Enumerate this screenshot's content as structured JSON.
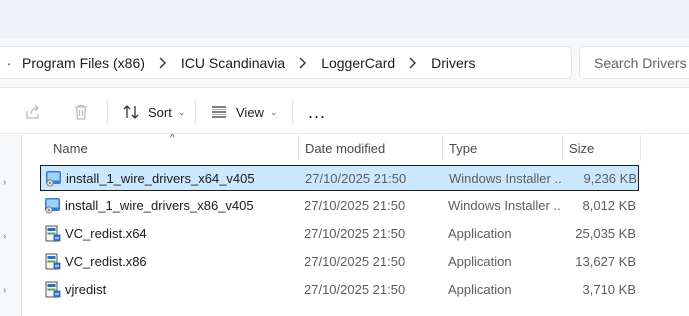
{
  "address": {
    "crumbs": [
      "Program Files (x86)",
      "ICU Scandinavia",
      "LoggerCard",
      "Drivers"
    ]
  },
  "search": {
    "placeholder": "Search Drivers"
  },
  "toolbar": {
    "sort_label": "Sort",
    "view_label": "View",
    "more_label": "..."
  },
  "columns": {
    "name": "Name",
    "date": "Date modified",
    "type": "Type",
    "size": "Size"
  },
  "files": [
    {
      "name": "install_1_wire_drivers_x64_v405",
      "date": "27/10/2025 21:50",
      "type": "Windows Installer ...",
      "size": "9,236 KB",
      "icon": "msi-installer-icon",
      "selected": true
    },
    {
      "name": "install_1_wire_drivers_x86_v405",
      "date": "27/10/2025 21:50",
      "type": "Windows Installer ...",
      "size": "8,012 KB",
      "icon": "msi-installer-icon",
      "selected": false
    },
    {
      "name": "VC_redist.x64",
      "date": "27/10/2025 21:50",
      "type": "Application",
      "size": "25,035 KB",
      "icon": "setup-application-icon",
      "selected": false
    },
    {
      "name": "VC_redist.x86",
      "date": "27/10/2025 21:50",
      "type": "Application",
      "size": "13,627 KB",
      "icon": "setup-application-icon",
      "selected": false
    },
    {
      "name": "vjredist",
      "date": "27/10/2025 21:50",
      "type": "Application",
      "size": "3,710 KB",
      "icon": "setup-application-icon",
      "selected": false
    }
  ],
  "colors": {
    "selection_bg": "#cce8ff",
    "selection_border": "#1b1b1b"
  }
}
